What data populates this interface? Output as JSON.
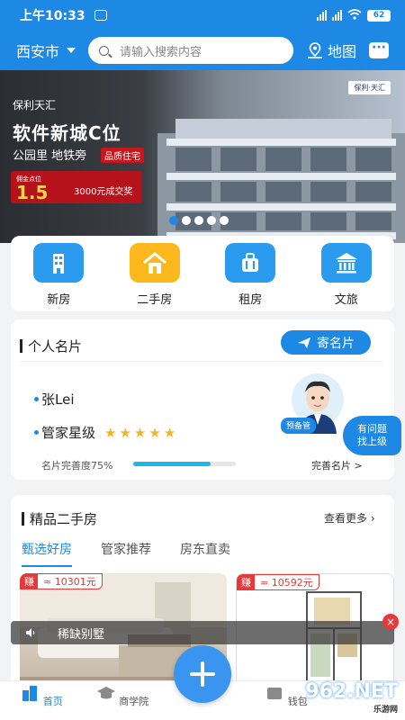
{
  "status": {
    "time": "上午10:33",
    "battery": "62"
  },
  "header": {
    "city": "西安市",
    "search_placeholder": "请输入搜索内容",
    "map_label": "地图"
  },
  "banner": {
    "brand": "保利天汇",
    "headline": "软件新城C位",
    "sub": "公园里 地铁旁",
    "tag": "品质住宅",
    "promo_small": "佣金点位",
    "promo_big": "1.5",
    "promo_right": "3000元成交奖",
    "logo": "保利·天汇"
  },
  "categories": [
    {
      "label": "新房",
      "icon": "building-icon",
      "color": "#2b9bf0"
    },
    {
      "label": "二手房",
      "icon": "house-icon",
      "color": "#fcb81c"
    },
    {
      "label": "租房",
      "icon": "suitcase-icon",
      "color": "#2b9bf0"
    },
    {
      "label": "文旅",
      "icon": "temple-icon",
      "color": "#2b9bf0"
    }
  ],
  "card": {
    "title": "个人名片",
    "send_label": "寄名片",
    "name": "张Lei",
    "level_label": "管家星级",
    "stars": 5,
    "progress_label": "名片完善度75%",
    "progress": 0.75,
    "complete_label": "完善名片 >",
    "ask_label": "有问题 找上级",
    "ask_line1": "有问题",
    "ask_line2": "找上级",
    "yubei_label": "预备管"
  },
  "listings": {
    "title": "精品二手房",
    "more": "查看更多",
    "tabs": [
      "甄选好房",
      "管家推荐",
      "房东直卖"
    ],
    "active_tab": 0,
    "items": [
      {
        "tag": "赚",
        "price": "≈ 10301元"
      },
      {
        "tag": "赚",
        "price": "≈ 10592元"
      }
    ]
  },
  "toast": {
    "text": "稀缺别墅"
  },
  "tabbar": {
    "items": [
      "首页",
      "商学院",
      "钱包"
    ],
    "active": 0
  },
  "watermark": {
    "main": "962.NET",
    "sub": "乐游网"
  }
}
